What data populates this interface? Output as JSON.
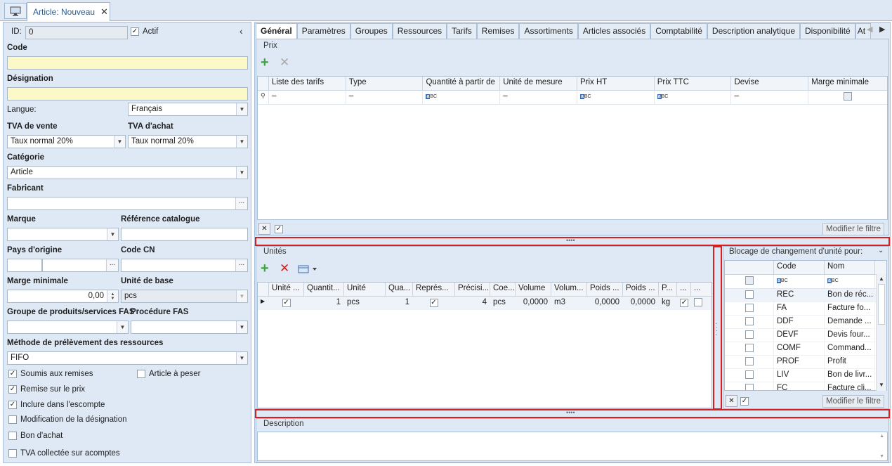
{
  "window": {
    "tab_title": "Article: Nouveau",
    "close": "✕"
  },
  "left": {
    "id_label": "ID:",
    "id_value": "0",
    "actif_label": "Actif",
    "code_label": "Code",
    "code_value": "",
    "designation_label": "Désignation",
    "designation_value": "",
    "langue_label": "Langue:",
    "langue_value": "Français",
    "tva_vente_label": "TVA de vente",
    "tva_vente_value": "Taux normal 20%",
    "tva_achat_label": "TVA d'achat",
    "tva_achat_value": "Taux normal 20%",
    "categorie_label": "Catégorie",
    "categorie_value": "Article",
    "fabricant_label": "Fabricant",
    "marque_label": "Marque",
    "ref_label": "Référence catalogue",
    "pays_label": "Pays d'origine",
    "code_cn_label": "Code CN",
    "marge_label": "Marge minimale",
    "marge_value": "0,00",
    "unite_label": "Unité de base",
    "unite_value": "pcs",
    "groupe_label": "Groupe de produits/services FAS",
    "proc_label": "Procédure FAS",
    "methode_label": "Méthode de prélèvement des ressources",
    "methode_value": "FIFO",
    "checks": {
      "soumis": "Soumis aux remises",
      "peser": "Article à peser",
      "remise": "Remise sur le prix",
      "escompte": "Inclure dans l'escompte",
      "modif": "Modification de la désignation",
      "bon": "Bon d'achat",
      "tva": "TVA collectée sur acomptes"
    }
  },
  "tabs": [
    "Général",
    "Paramètres",
    "Groupes",
    "Ressources",
    "Tarifs",
    "Remises",
    "Assortiments",
    "Articles associés",
    "Comptabilité",
    "Description analytique",
    "Disponibilité",
    "At"
  ],
  "prix": {
    "title": "Prix",
    "columns": [
      "Liste des tarifs",
      "Type",
      "Quantité à partir de",
      "Unité de mesure",
      "Prix HT",
      "Prix TTC",
      "Devise",
      "Marge minimale"
    ],
    "filter_btn": "Modifier le filtre"
  },
  "unites": {
    "title": "Unités",
    "columns": [
      "Unité ...",
      "Quantit...",
      "Unité",
      "Qua...",
      "Représ...",
      "Précisi...",
      "Coe...",
      "Volume",
      "Volum...",
      "Poids ...",
      "Poids ...",
      "P...",
      "...",
      "..."
    ],
    "row": {
      "qty": "1",
      "unit": "pcs",
      "qua": "1",
      "prec": "4",
      "coe": "pcs",
      "volume": "0,0000",
      "volum": "m3",
      "poids1": "0,0000",
      "poids2": "0,0000",
      "p": "kg"
    }
  },
  "blocage": {
    "title": "Blocage de changement d'unité pour:",
    "col_code": "Code",
    "col_nom": "Nom",
    "rows": [
      {
        "code": "REC",
        "nom": "Bon de réc..."
      },
      {
        "code": "FA",
        "nom": "Facture fo..."
      },
      {
        "code": "DDF",
        "nom": "Demande ..."
      },
      {
        "code": "DEVF",
        "nom": "Devis four..."
      },
      {
        "code": "COMF",
        "nom": "Command..."
      },
      {
        "code": "PROF",
        "nom": "Profit"
      },
      {
        "code": "LIV",
        "nom": "Bon de livr..."
      },
      {
        "code": "FC",
        "nom": "Facture cli..."
      }
    ],
    "filter_btn": "Modifier le filtre"
  },
  "description": {
    "title": "Description"
  },
  "colors": {
    "accent": "#2b5b8f",
    "highlight": "#d81e1e",
    "panel": "#dfe9f5"
  }
}
